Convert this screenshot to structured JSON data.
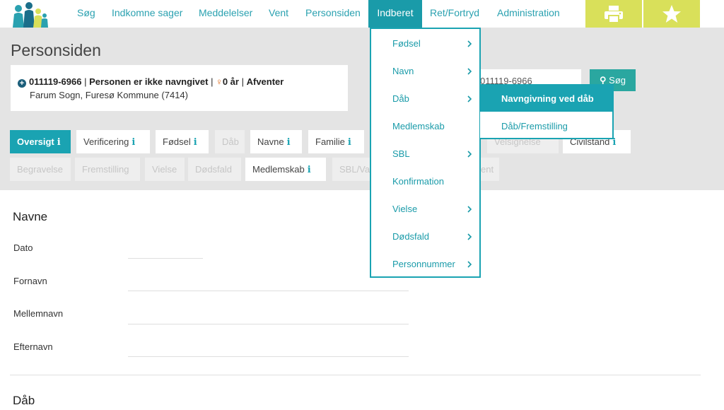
{
  "nav": {
    "items": [
      "Søg",
      "Indkomne sager",
      "Meddelelser",
      "Vent",
      "Personsiden",
      "Indberet",
      "Ret/Fortryd",
      "Administration"
    ],
    "active": "Indberet",
    "print_icon": "printer-icon",
    "favorite_icon": "star-icon"
  },
  "page": {
    "title": "Personsiden"
  },
  "person": {
    "cpr": "011119-6966",
    "name_status": "Personen er ikke navngivet",
    "age": "0 år",
    "status": "Afventer",
    "location": "Farum Sogn, Furesø Kommune (7414)"
  },
  "search": {
    "value": "011119-6966",
    "button_label": "Søg"
  },
  "tabs": {
    "row1": [
      {
        "label": "Oversigt",
        "state": "active",
        "info": true
      },
      {
        "label": "Verificering",
        "state": "enabled",
        "info": true
      },
      {
        "label": "Fødsel",
        "state": "enabled",
        "info": true
      },
      {
        "label": "Dåb",
        "state": "disabled",
        "info": false
      },
      {
        "label": "Navne",
        "state": "enabled",
        "info": true
      },
      {
        "label": "Familie",
        "state": "enabled",
        "info": true
      },
      {
        "label": "Velsignelse",
        "state": "disabled",
        "info": false
      },
      {
        "label": "Civilstand",
        "state": "enabled",
        "info": true
      }
    ],
    "row2": [
      {
        "label": "Begravelse",
        "state": "disabled",
        "info": false
      },
      {
        "label": "Fremstilling",
        "state": "disabled",
        "info": false
      },
      {
        "label": "Vielse",
        "state": "disabled",
        "info": false
      },
      {
        "label": "Dødsfald",
        "state": "disabled",
        "info": false
      },
      {
        "label": "Medlemskab",
        "state": "enabled",
        "info": true
      },
      {
        "label": "SBL/Va",
        "state": "disabled",
        "info": false
      },
      {
        "label": "ent",
        "state": "disabled",
        "info": false
      }
    ],
    "info_glyph": "i"
  },
  "names_section": {
    "title": "Navne",
    "fields": [
      "Dato",
      "Fornavn",
      "Mellemnavn",
      "Efternavn"
    ]
  },
  "baptism_section": {
    "title": "Dåb"
  },
  "dropdown": {
    "items": [
      {
        "label": "Fødsel",
        "submenu": true
      },
      {
        "label": "Navn",
        "submenu": true
      },
      {
        "label": "Dåb",
        "submenu": true
      },
      {
        "label": "Medlemskab",
        "submenu": false
      },
      {
        "label": "SBL",
        "submenu": true
      },
      {
        "label": "Konfirmation",
        "submenu": false
      },
      {
        "label": "Vielse",
        "submenu": true
      },
      {
        "label": "Dødsfald",
        "submenu": true
      },
      {
        "label": "Personnummer",
        "submenu": true
      }
    ],
    "submenu": {
      "items": [
        "Navngivning ved dåb",
        "Dåb/Fremstilling"
      ],
      "highlighted": "Navngivning ved dåb"
    }
  },
  "colors": {
    "accent": "#1aa3b2",
    "brand_button": "#d9e05a",
    "search_button": "#2aa7a0",
    "header_band": "#e4e4e4"
  }
}
